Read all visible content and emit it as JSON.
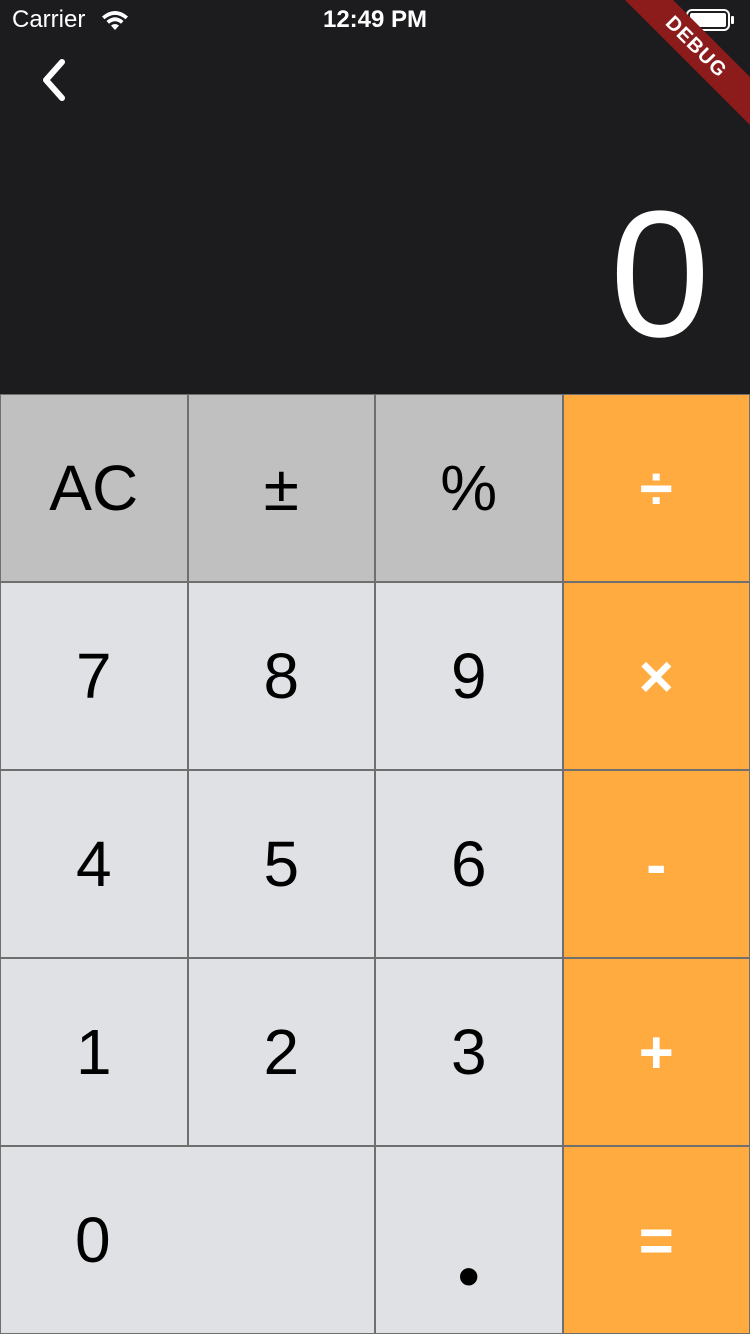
{
  "status_bar": {
    "carrier": "Carrier",
    "time": "12:49 PM",
    "wifi_icon": "wifi-icon",
    "battery_icon": "battery-icon"
  },
  "debug_banner": "DEBUG",
  "nav": {
    "back_icon": "chevron-left-icon"
  },
  "display": {
    "value": "0"
  },
  "colors": {
    "background": "#1c1b1e",
    "function_key": "#c0c0c1",
    "number_key": "#e0e1e5",
    "operator_key": "#ffab40",
    "debug_ribbon": "#8c1c1c"
  },
  "keys": {
    "ac": "AC",
    "plus_minus": "±",
    "percent": "%",
    "divide": "÷",
    "seven": "7",
    "eight": "8",
    "nine": "9",
    "multiply": "×",
    "four": "4",
    "five": "5",
    "six": "6",
    "minus": "-",
    "one": "1",
    "two": "2",
    "three": "3",
    "plus": "+",
    "zero": "0",
    "decimal": "•",
    "equals": "="
  }
}
